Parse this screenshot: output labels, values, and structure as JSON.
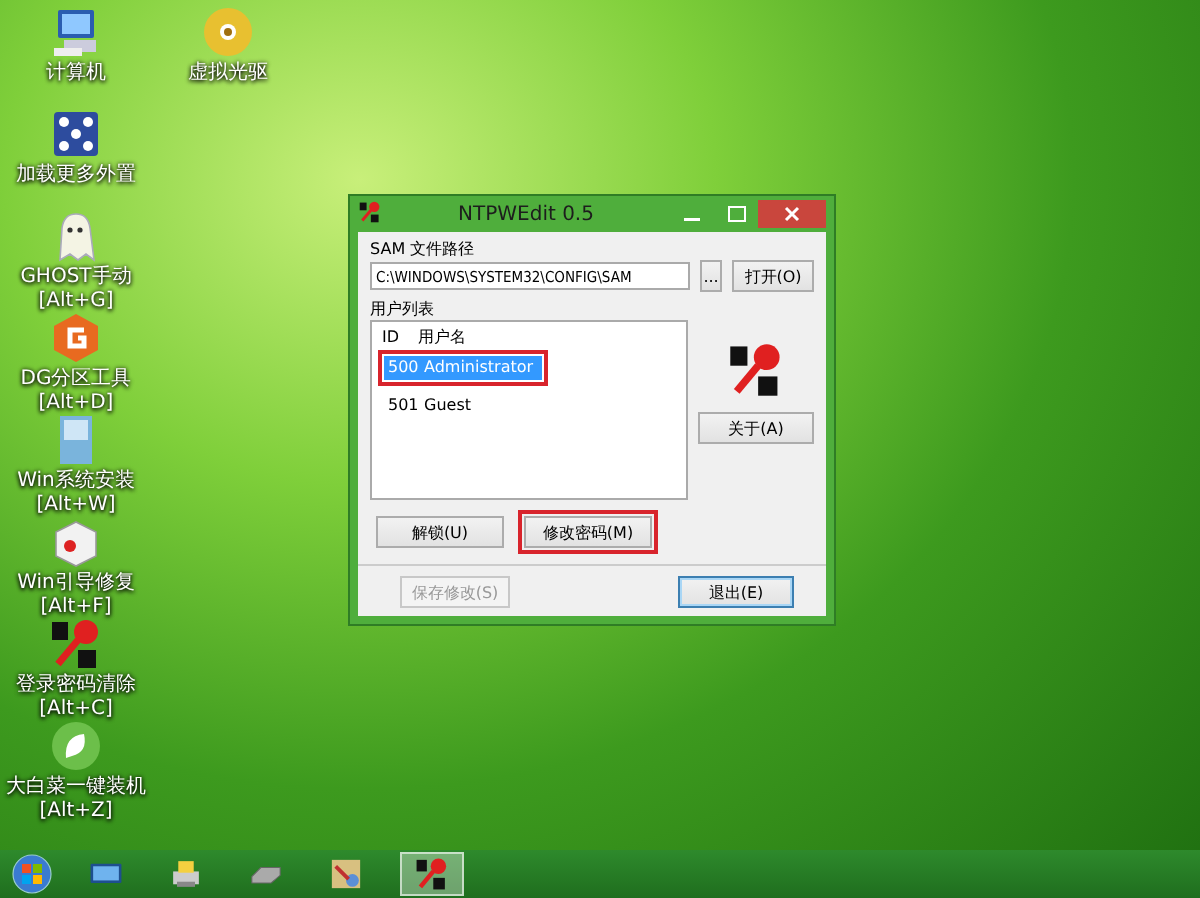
{
  "desktop": {
    "column_1": [
      {
        "kind": "computer",
        "label": "计算机"
      },
      {
        "kind": "network",
        "label": "加载更多外置"
      },
      {
        "kind": "ghost",
        "label": "GHOST手动",
        "hotkey": "[Alt+G]"
      },
      {
        "kind": "partition",
        "label": "DG分区工具",
        "hotkey": "[Alt+D]"
      },
      {
        "kind": "installer",
        "label": "Win系统安装",
        "hotkey": "[Alt+W]"
      },
      {
        "kind": "repair",
        "label": "Win引导修复",
        "hotkey": "[Alt+F]"
      },
      {
        "kind": "ntkey",
        "label": "登录密码清除",
        "hotkey": "[Alt+C]"
      },
      {
        "kind": "leaf",
        "label": "大白菜一键装机",
        "hotkey": "[Alt+Z]"
      }
    ],
    "column_2": [
      {
        "kind": "disc",
        "label": "虚拟光驱"
      }
    ]
  },
  "window": {
    "title": "NTPWEdit 0.5",
    "sam_label": "SAM 文件路径",
    "sam_path": "C:\\WINDOWS\\SYSTEM32\\CONFIG\\SAM",
    "browse_button": "...",
    "open_button": "打开(O)",
    "user_list_label": "用户列表",
    "columns": [
      "ID",
      "用户名"
    ],
    "users": [
      {
        "id": "500",
        "name": "Administrator",
        "selected": true,
        "highlighted": true
      },
      {
        "id": "501",
        "name": "Guest",
        "selected": false,
        "highlighted": false
      }
    ],
    "about_button": "关于(A)",
    "buttons": [
      {
        "label": "解锁(U)",
        "highlighted": false
      },
      {
        "label": "修改密码(M)",
        "highlighted": true
      }
    ],
    "save_button": {
      "label": "保存修改(S)",
      "disabled": true
    },
    "exit_button": {
      "label": "退出(E)",
      "default": true
    }
  },
  "taskbar": {
    "items": [
      {
        "kind": "monitor",
        "active": false
      },
      {
        "kind": "printer",
        "active": false
      },
      {
        "kind": "drive",
        "active": false
      },
      {
        "kind": "tools",
        "active": false
      },
      {
        "kind": "ntkey",
        "active": true
      }
    ]
  }
}
